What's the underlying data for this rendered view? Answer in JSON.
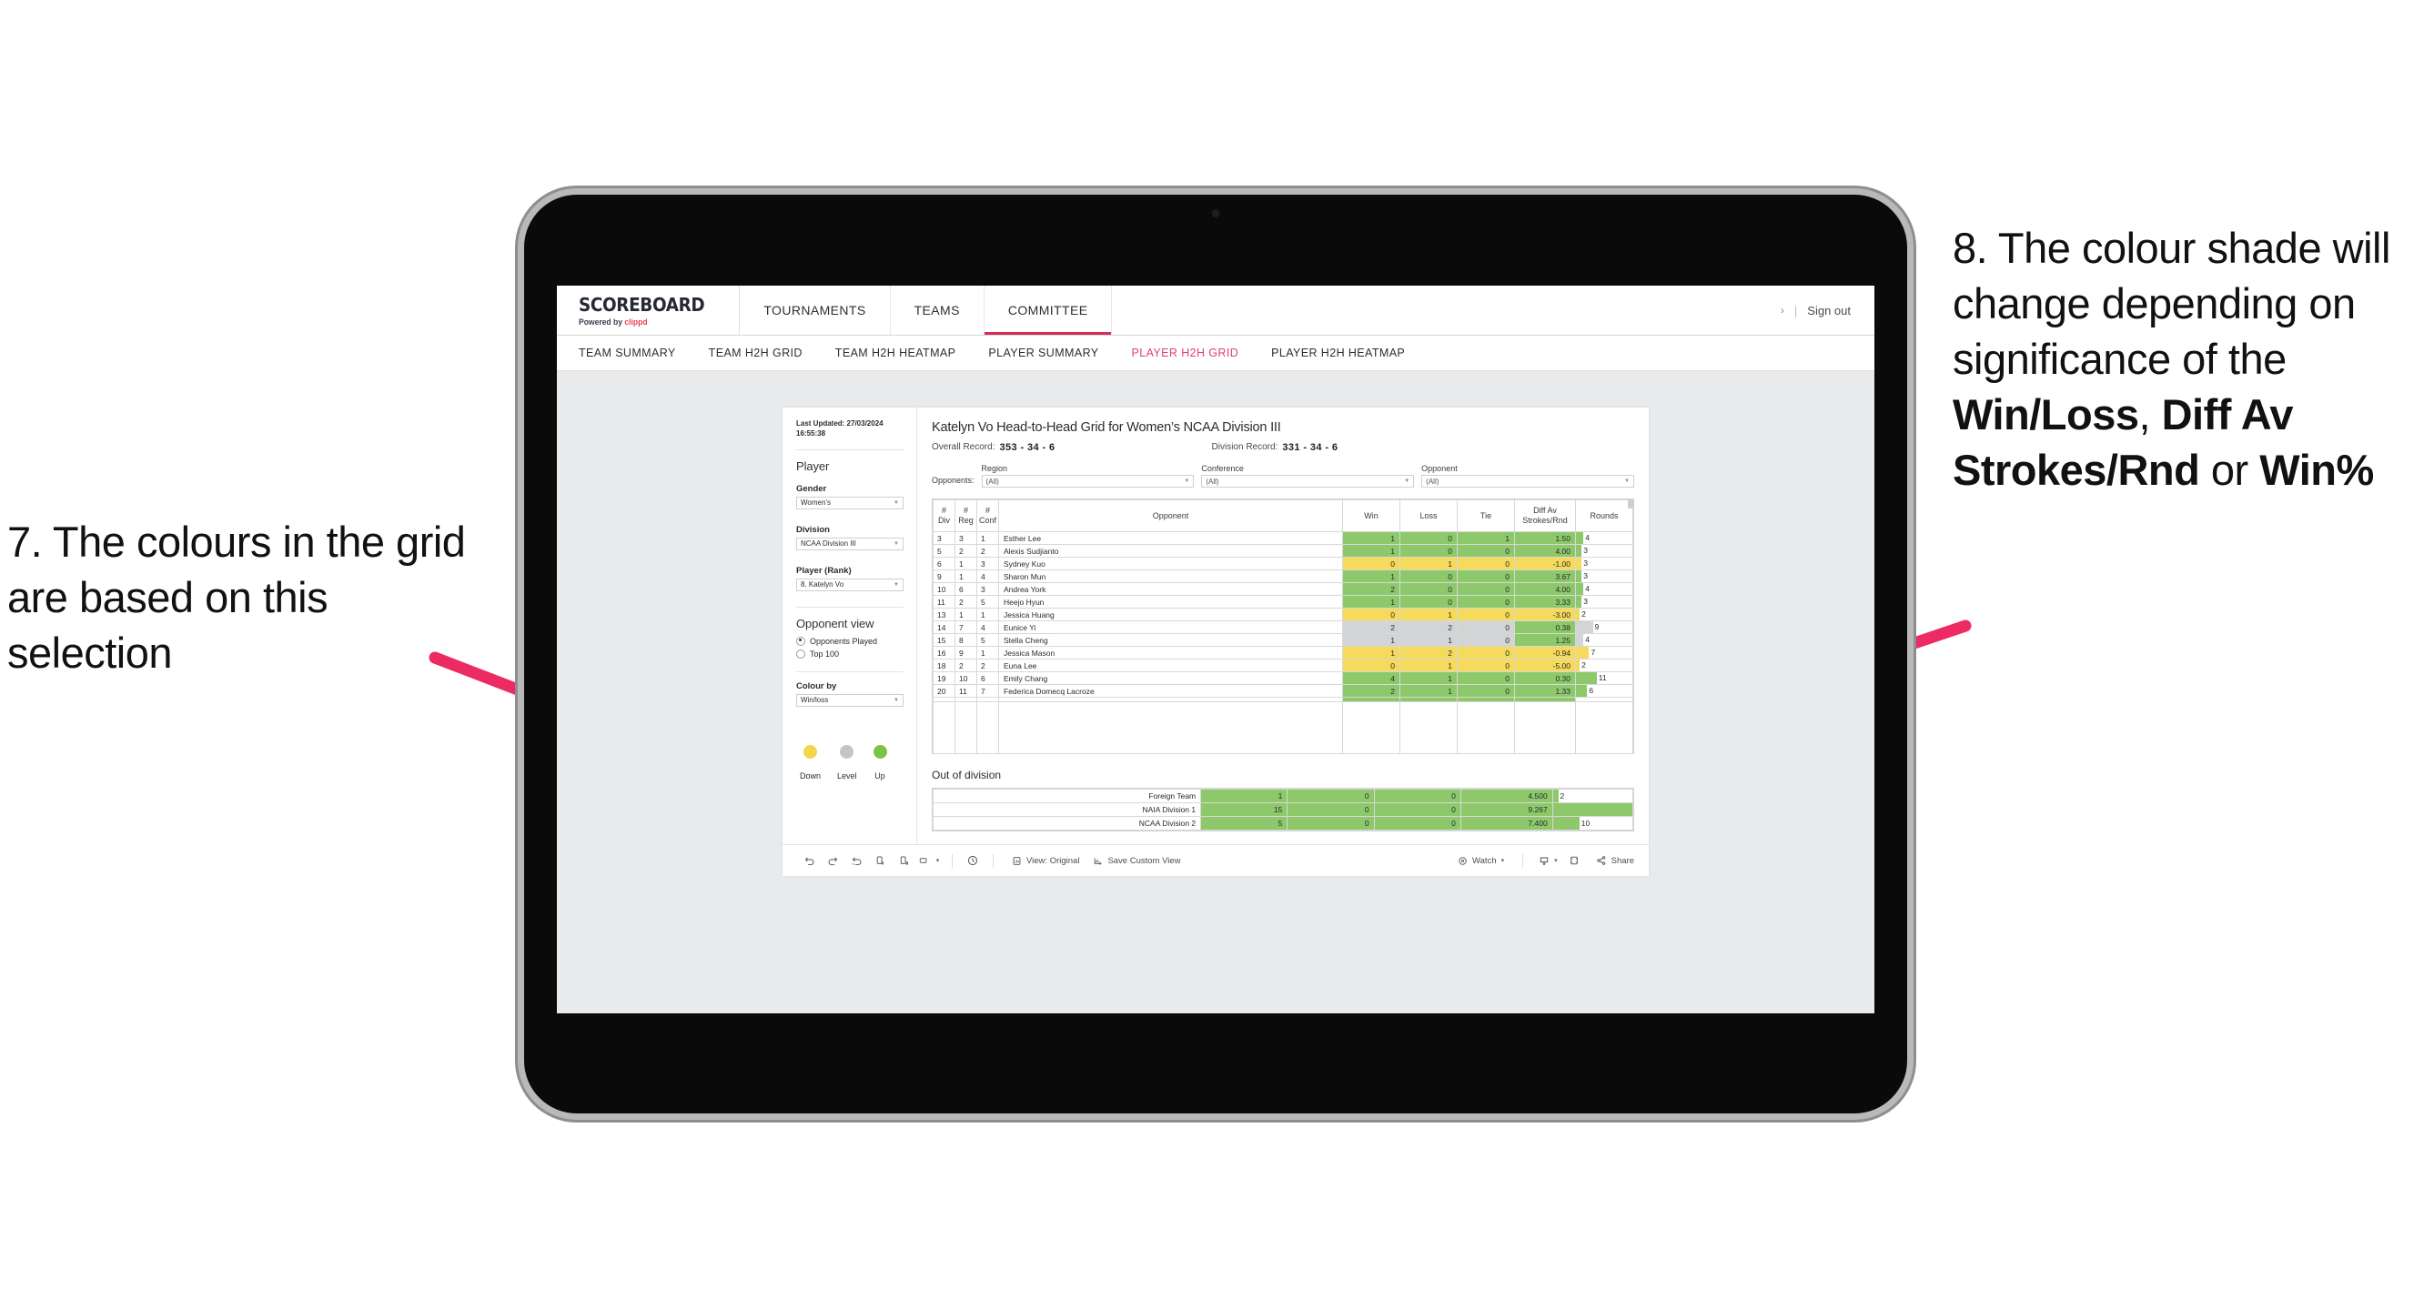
{
  "annotations": {
    "left": "7. The colours in the grid are based on this selection",
    "right_pre": "8. The colour shade will change depending on significance of the ",
    "right_b1": "Win/Loss",
    "right_mid1": ", ",
    "right_b2": "Diff Av Strokes/Rnd",
    "right_mid2": " or ",
    "right_b3": "Win%",
    "arrow_color": "#EC2B62"
  },
  "topbar": {
    "logo_word": "SCOREBOARD",
    "logo_sub_pre": "Powered by ",
    "logo_brand": "clippd",
    "nav": [
      {
        "label": "TOURNAMENTS",
        "active": false
      },
      {
        "label": "TEAMS",
        "active": false
      },
      {
        "label": "COMMITTEE",
        "active": true
      }
    ],
    "chevron": "›",
    "separator": "|",
    "signout": "Sign out"
  },
  "subnav": [
    {
      "label": "TEAM SUMMARY",
      "active": false
    },
    {
      "label": "TEAM H2H GRID",
      "active": false
    },
    {
      "label": "TEAM H2H HEATMAP",
      "active": false
    },
    {
      "label": "PLAYER SUMMARY",
      "active": false
    },
    {
      "label": "PLAYER H2H GRID",
      "active": true
    },
    {
      "label": "PLAYER H2H HEATMAP",
      "active": false
    }
  ],
  "sidebar": {
    "last_updated": "Last Updated: 27/03/2024 16:55:38",
    "player_heading": "Player",
    "gender_label": "Gender",
    "gender_value": "Women’s",
    "division_label": "Division",
    "division_value": "NCAA Division III",
    "player_rank_label": "Player (Rank)",
    "player_rank_value": "8. Katelyn Vo",
    "opponent_view_heading": "Opponent view",
    "radio_opponents_played": "Opponents Played",
    "radio_top100": "Top 100",
    "colour_by_label": "Colour by",
    "colour_by_value": "Win/loss",
    "legend": [
      {
        "label": "Down",
        "color": "#F3D54E"
      },
      {
        "label": "Level",
        "color": "#C3C6C8"
      },
      {
        "label": "Up",
        "color": "#7DC242"
      }
    ]
  },
  "main": {
    "title": "Katelyn Vo Head-to-Head Grid for Women’s NCAA Division III",
    "overall_label": "Overall Record:",
    "overall_value": "353 - 34 - 6",
    "division_label": "Division Record:",
    "division_value": "331 - 34 - 6",
    "opponents_label": "Opponents:",
    "filters": [
      {
        "label": "Region",
        "value": "(All)"
      },
      {
        "label": "Conference",
        "value": "(All)"
      },
      {
        "label": "Opponent",
        "value": "(All)"
      }
    ],
    "columns": [
      "# Div",
      "# Reg",
      "# Conf",
      "Opponent",
      "Win",
      "Loss",
      "Tie",
      "Diff Av Strokes/Rnd",
      "Rounds"
    ],
    "out_of_division_heading": "Out of division"
  },
  "chart_data": {
    "type": "table",
    "title": "Katelyn Vo Head-to-Head Grid for Women’s NCAA Division III",
    "colour_by": "Win/loss",
    "colors": {
      "up": "#8DC96A",
      "down": "#F5DA5C",
      "level": "#D2D4D6",
      "bar_bg": "#ffffff"
    },
    "columns": [
      "# Div",
      "# Reg",
      "# Conf",
      "Opponent",
      "Win",
      "Loss",
      "Tie",
      "Diff Av Strokes/Rnd",
      "Rounds"
    ],
    "rounds_max": 30,
    "rows": [
      {
        "div": "3",
        "reg": "3",
        "conf": "1",
        "opponent": "Esther Lee",
        "win": "1",
        "loss": "0",
        "tie": "1",
        "diff": "1.50",
        "rounds": "4",
        "state": "up"
      },
      {
        "div": "5",
        "reg": "2",
        "conf": "2",
        "opponent": "Alexis Sudjianto",
        "win": "1",
        "loss": "0",
        "tie": "0",
        "diff": "4.00",
        "rounds": "3",
        "state": "up"
      },
      {
        "div": "6",
        "reg": "1",
        "conf": "3",
        "opponent": "Sydney Kuo",
        "win": "0",
        "loss": "1",
        "tie": "0",
        "diff": "-1.00",
        "rounds": "3",
        "state": "down"
      },
      {
        "div": "9",
        "reg": "1",
        "conf": "4",
        "opponent": "Sharon Mun",
        "win": "1",
        "loss": "0",
        "tie": "0",
        "diff": "3.67",
        "rounds": "3",
        "state": "up"
      },
      {
        "div": "10",
        "reg": "6",
        "conf": "3",
        "opponent": "Andrea York",
        "win": "2",
        "loss": "0",
        "tie": "0",
        "diff": "4.00",
        "rounds": "4",
        "state": "up"
      },
      {
        "div": "11",
        "reg": "2",
        "conf": "5",
        "opponent": "Heejo Hyun",
        "win": "1",
        "loss": "0",
        "tie": "0",
        "diff": "3.33",
        "rounds": "3",
        "state": "up"
      },
      {
        "div": "13",
        "reg": "1",
        "conf": "1",
        "opponent": "Jessica Huang",
        "win": "0",
        "loss": "1",
        "tie": "0",
        "diff": "-3.00",
        "rounds": "2",
        "state": "down"
      },
      {
        "div": "14",
        "reg": "7",
        "conf": "4",
        "opponent": "Eunice Yi",
        "win": "2",
        "loss": "2",
        "tie": "0",
        "diff": "0.38",
        "rounds": "9",
        "state": "level",
        "diff_state": "up"
      },
      {
        "div": "15",
        "reg": "8",
        "conf": "5",
        "opponent": "Stella Cheng",
        "win": "1",
        "loss": "1",
        "tie": "0",
        "diff": "1.25",
        "rounds": "4",
        "state": "level",
        "diff_state": "up"
      },
      {
        "div": "16",
        "reg": "9",
        "conf": "1",
        "opponent": "Jessica Mason",
        "win": "1",
        "loss": "2",
        "tie": "0",
        "diff": "-0.94",
        "rounds": "7",
        "state": "down"
      },
      {
        "div": "18",
        "reg": "2",
        "conf": "2",
        "opponent": "Euna Lee",
        "win": "0",
        "loss": "1",
        "tie": "0",
        "diff": "-5.00",
        "rounds": "2",
        "state": "down"
      },
      {
        "div": "19",
        "reg": "10",
        "conf": "6",
        "opponent": "Emily Chang",
        "win": "4",
        "loss": "1",
        "tie": "0",
        "diff": "0.30",
        "rounds": "11",
        "state": "up"
      },
      {
        "div": "20",
        "reg": "11",
        "conf": "7",
        "opponent": "Federica Domecq Lacroze",
        "win": "2",
        "loss": "1",
        "tie": "0",
        "diff": "1.33",
        "rounds": "6",
        "state": "up"
      }
    ],
    "out_of_division": {
      "rounds_max": 30,
      "rows": [
        {
          "name": "Foreign Team",
          "win": "1",
          "loss": "0",
          "tie": "0",
          "diff": "4.500",
          "rounds": "2",
          "state": "up"
        },
        {
          "name": "NAIA Division 1",
          "win": "15",
          "loss": "0",
          "tie": "0",
          "diff": "9.267",
          "rounds": "30",
          "state": "up"
        },
        {
          "name": "NCAA Division 2",
          "win": "5",
          "loss": "0",
          "tie": "0",
          "diff": "7.400",
          "rounds": "10",
          "state": "up"
        }
      ]
    }
  },
  "toolbar": {
    "undo": "undo-icon",
    "redo": "redo-icon",
    "revert": "revert-icon",
    "refresh": "refresh-data-icon",
    "pause": "pause-updates-icon",
    "view_dropdown": "view-dropdown-icon",
    "history": "history-icon",
    "view_original_label": "View: Original",
    "save_custom_view_label": "Save Custom View",
    "watch_label": "Watch",
    "download_label": "download-icon",
    "fullscreen_label": "fullscreen-icon",
    "share_label": "Share",
    "caret": "▾"
  }
}
